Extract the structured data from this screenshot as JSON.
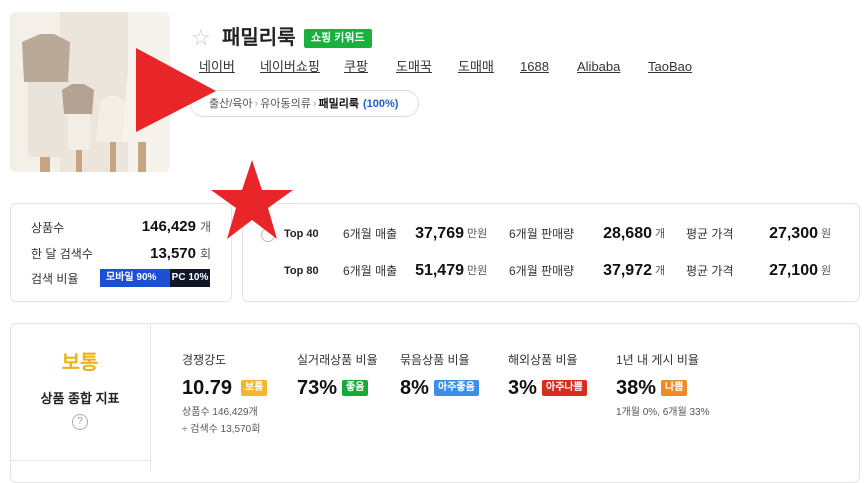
{
  "header": {
    "keyword": "패밀리룩",
    "badge": "쇼핑 키워드",
    "markets": [
      "네이버",
      "네이버쇼핑",
      "쿠팡",
      "도매꾹",
      "도매매",
      "1688",
      "Alibaba",
      "TaoBao"
    ],
    "category": {
      "path": [
        "출산/육아",
        "유아동의류",
        "패밀리룩"
      ],
      "percent": "(100%)"
    }
  },
  "stats": {
    "products_label": "상품수",
    "products_value": "146,429",
    "products_unit": "개",
    "monthly_search_label": "한 달 검색수",
    "monthly_search_value": "13,570",
    "monthly_search_unit": "회",
    "search_ratio_label": "검색 비율",
    "mobile": "모바일 90%",
    "pc": "PC 10%",
    "mobile_ratio": 0.9
  },
  "top": [
    {
      "label": "Top 40",
      "sales_label": "6개월 매출",
      "sales_value": "37,769",
      "sales_unit": "만원",
      "qty_label": "6개월 판매량",
      "qty_value": "28,680",
      "qty_unit": "개",
      "price_label": "평균 가격",
      "price_value": "27,300",
      "price_unit": "원"
    },
    {
      "label": "Top 80",
      "sales_label": "6개월 매출",
      "sales_value": "51,479",
      "sales_unit": "만원",
      "qty_label": "6개월 판매량",
      "qty_value": "37,972",
      "qty_unit": "개",
      "price_label": "평균 가격",
      "price_value": "27,100",
      "price_unit": "원"
    }
  ],
  "score": {
    "grade": "보통",
    "title": "상품 종합 지표",
    "help": "?",
    "grade_color": "#f0b20f",
    "indicators": [
      {
        "label": "경쟁강도",
        "value": "10.79",
        "tag": "보통",
        "tag_color": "#f5b72a",
        "note1": "상품수 146,429개",
        "note2": "÷ 검색수 13,570회"
      },
      {
        "label": "실거래상품 비율",
        "value": "73%",
        "tag": "좋음",
        "tag_color": "#19a83a"
      },
      {
        "label": "묶음상품 비율",
        "value": "8%",
        "tag": "아주좋음",
        "tag_color": "#3b8ee8"
      },
      {
        "label": "해외상품 비율",
        "value": "3%",
        "tag": "아주나쁨",
        "tag_color": "#d62d1f"
      },
      {
        "label": "1년 내 게시 비율",
        "value": "38%",
        "tag": "나쁨",
        "tag_color": "#f08a24",
        "note1": "1개월 0%, 6개월 33%"
      }
    ]
  }
}
